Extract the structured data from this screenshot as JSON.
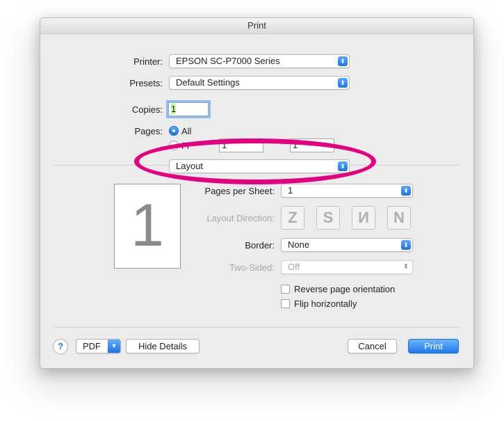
{
  "window": {
    "title": "Print"
  },
  "printer": {
    "label": "Printer:",
    "value": "EPSON SC-P7000 Series"
  },
  "presets": {
    "label": "Presets:",
    "value": "Default Settings"
  },
  "copies": {
    "label": "Copies:",
    "value": "1"
  },
  "pages": {
    "label": "Pages:",
    "all_label": "All",
    "from_label": "Fr",
    "from_value": "1",
    "to_value": "1"
  },
  "section_popup": {
    "value": "Layout"
  },
  "preview": {
    "page_number": "1"
  },
  "layout": {
    "pages_per_sheet_label": "Pages per Sheet:",
    "pages_per_sheet_value": "1",
    "direction_label": "Layout Direction:",
    "direction_glyphs": [
      "Z",
      "S",
      "И",
      "N"
    ],
    "border_label": "Border:",
    "border_value": "None",
    "two_sided_label": "Two-Sided:",
    "two_sided_value": "Off",
    "reverse_label": "Reverse page orientation",
    "flip_label": "Flip horizontally"
  },
  "footer": {
    "help_glyph": "?",
    "pdf_label": "PDF",
    "hide_details_label": "Hide Details",
    "cancel_label": "Cancel",
    "print_label": "Print"
  },
  "colors": {
    "accent": "#1b72e6",
    "highlight": "#e4007f"
  }
}
